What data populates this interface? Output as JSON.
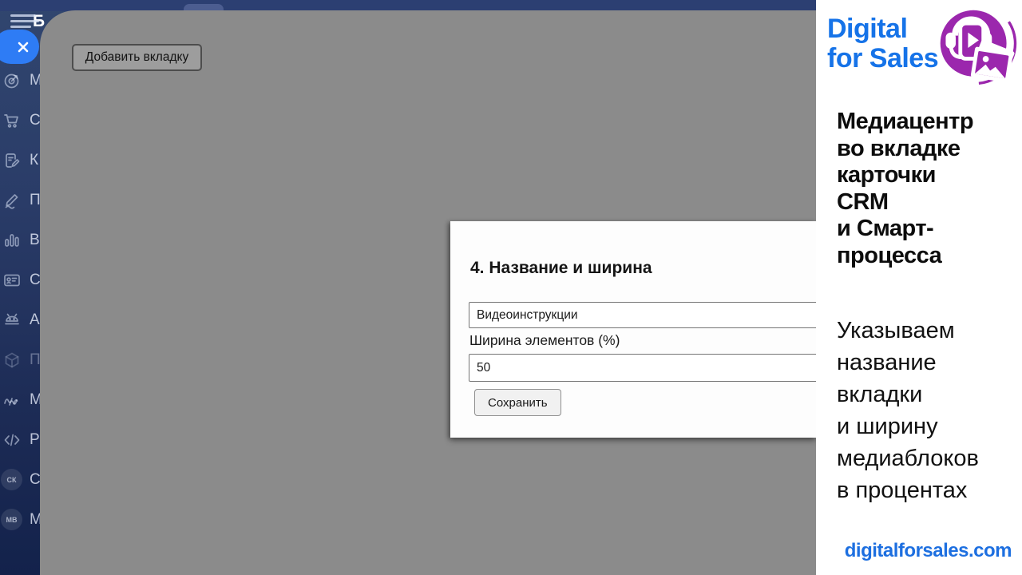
{
  "sidebar": {
    "menu_letter": "Б",
    "items": [
      {
        "icon": "target-icon",
        "label": "М"
      },
      {
        "icon": "cart-icon",
        "label": "С"
      },
      {
        "icon": "document-icon",
        "label": "К"
      },
      {
        "icon": "pencil-icon",
        "label": "П"
      },
      {
        "icon": "bar-chart-icon",
        "label": "В"
      },
      {
        "icon": "contact-card-icon",
        "label": "С"
      },
      {
        "icon": "robot-icon",
        "label": "А"
      },
      {
        "icon": "cube-icon",
        "label": "П"
      },
      {
        "icon": "waves-icon",
        "label": "М"
      },
      {
        "icon": "code-icon",
        "label": "Р"
      },
      {
        "icon": "sk-badge-icon",
        "label": "С",
        "badge": "СК"
      },
      {
        "icon": "mv-badge-icon",
        "label": "М",
        "badge": "МВ"
      }
    ]
  },
  "content": {
    "add_tab_button": "Добавить вкладку",
    "dialog": {
      "title": "4. Название и ширина",
      "tab_name_value": "Видеоинструкции",
      "width_label": "Ширина элементов (%)",
      "width_value": "50",
      "save_button": "Сохранить"
    }
  },
  "promo": {
    "brand_line1": "Digital",
    "brand_line2": "for Sales",
    "heading_line1": "Медиацентр",
    "heading_line2": "во вкладке",
    "heading_line3": "карточки",
    "heading_line4": "CRM",
    "heading_line5": "и Смарт-",
    "heading_line6": "процесса",
    "body_line1": "Указываем",
    "body_line2": "название",
    "body_line3": "вкладки",
    "body_line4": "и ширину",
    "body_line5": "медиаблоков",
    "body_line6": "в процентах",
    "website": "digitalforsales.com",
    "colors": {
      "brand_blue": "#1673e8",
      "logo_purple": "#9b27ad"
    }
  }
}
